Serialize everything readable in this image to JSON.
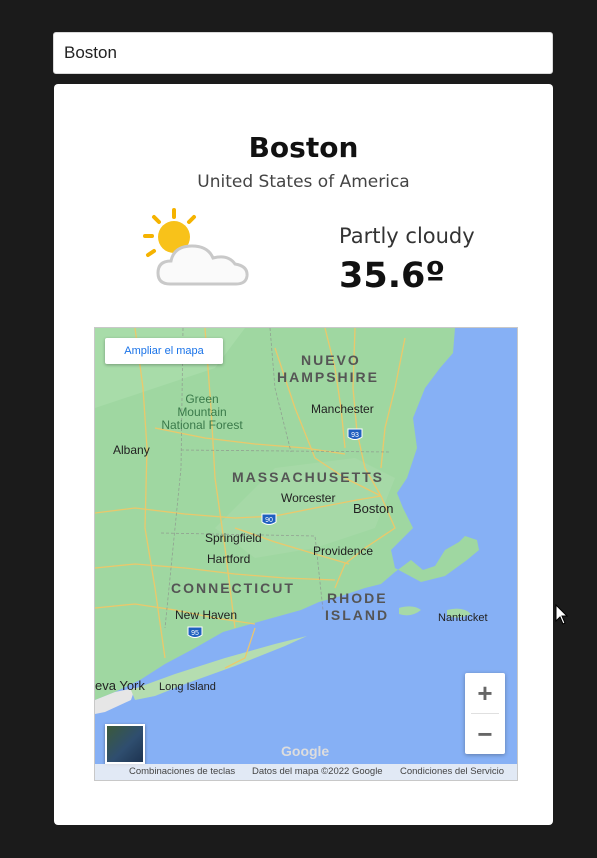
{
  "search": {
    "value": "Boston"
  },
  "weather": {
    "city": "Boston",
    "country": "United States of America",
    "condition": "Partly cloudy",
    "temperature": "35.6º",
    "icon": "partly-cloudy-icon"
  },
  "map": {
    "enlarge_label": "Ampliar el mapa",
    "states": [
      "NUEVO",
      "HAMPSHIRE",
      "MASSACHUSETTS",
      "CONNECTICUT",
      "RHODE",
      "ISLAND"
    ],
    "park": [
      "Green",
      "Mountain",
      "National Forest"
    ],
    "cities": [
      "Manchester",
      "Albany",
      "Worcester",
      "Boston",
      "Springfield",
      "Hartford",
      "Providence",
      "New Haven",
      "Nantucket",
      "eva York",
      "Long Island"
    ],
    "highway_shields": [
      "93",
      "90",
      "95"
    ],
    "zoom_in": "+",
    "zoom_out": "−",
    "logo": "Google",
    "footer": [
      "Combinaciones de teclas",
      "Datos del mapa ©2022 Google",
      "Condiciones del Servicio"
    ]
  }
}
